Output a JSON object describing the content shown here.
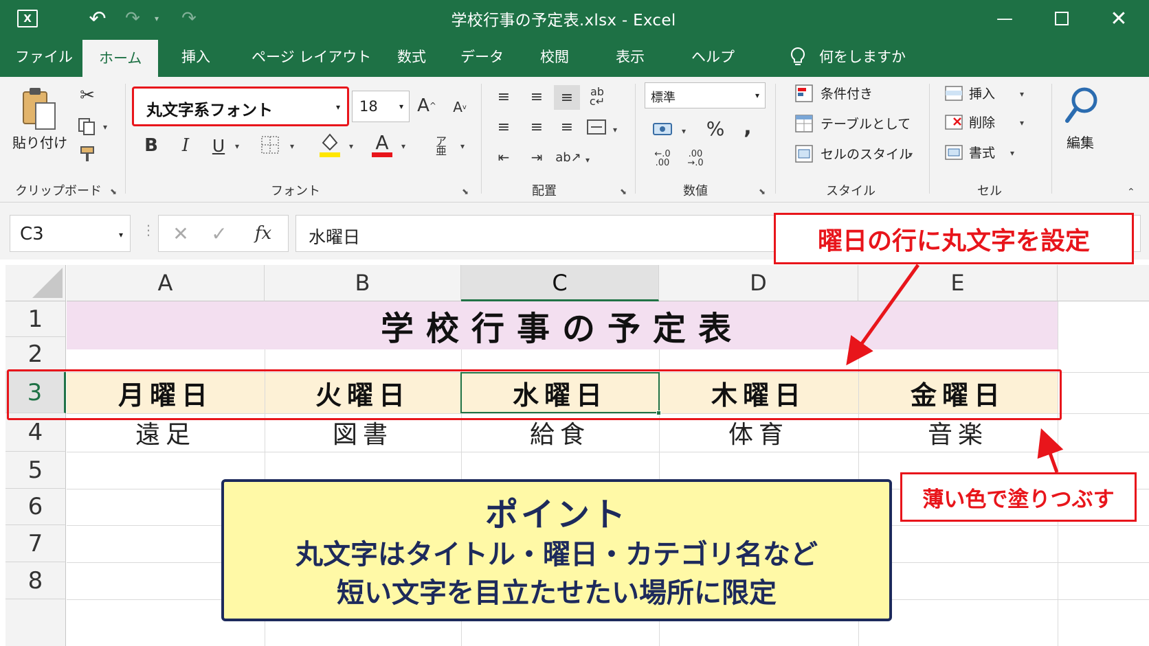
{
  "window": {
    "title": "学校行事の予定表.xlsx  -  Excel",
    "app_icon": "excel-logo-icon"
  },
  "ribbon_tabs": [
    {
      "label": "ファイル"
    },
    {
      "label": "ホーム",
      "active": true
    },
    {
      "label": "挿入"
    },
    {
      "label": "ページ レイアウト"
    },
    {
      "label": "数式"
    },
    {
      "label": "データ"
    },
    {
      "label": "校閲"
    },
    {
      "label": "表示"
    },
    {
      "label": "ヘルプ"
    }
  ],
  "tell_me": {
    "label": "何をしますか",
    "icon": "lightbulb-icon"
  },
  "ribbon": {
    "clipboard": {
      "paste_label": "貼り付け",
      "group_label": "クリップボード"
    },
    "font": {
      "name": "丸文字系フォント",
      "size": "18",
      "bold": "B",
      "italic": "I",
      "underline": "U",
      "group_label": "フォント",
      "fill_color": "#ffe600",
      "font_color": "#e8151b"
    },
    "alignment": {
      "group_label": "配置"
    },
    "number": {
      "format": "標準",
      "percent": "%",
      "comma": ",",
      "group_label": "数値"
    },
    "styles": {
      "conditional": "条件付き",
      "as_table": "テーブルとして",
      "cell_styles": "セルのスタイル",
      "group_label": "スタイル"
    },
    "cells": {
      "insert": "挿入",
      "delete": "削除",
      "format": "書式",
      "group_label": "セル"
    },
    "editing": {
      "label": "編集"
    }
  },
  "formula_bar": {
    "name_box": "C3",
    "fx": "fx",
    "content": "水曜日"
  },
  "sheet": {
    "columns": [
      "A",
      "B",
      "C",
      "D",
      "E"
    ],
    "selected_column": "C",
    "rows": [
      "1",
      "2",
      "3",
      "4",
      "5",
      "6",
      "7",
      "8"
    ],
    "selected_row": "3",
    "title": "学校行事の予定表",
    "title_fill": "#f3dff0",
    "days": [
      "月曜日",
      "火曜日",
      "水曜日",
      "木曜日",
      "金曜日"
    ],
    "day_fill": "#fdf1d6",
    "events": [
      "遠足",
      "図書",
      "給食",
      "体育",
      "音楽"
    ]
  },
  "annotations": {
    "callout_top": "曜日の行に丸文字を設定",
    "callout_right": "薄い色で塗りつぶす",
    "point_title": "ポイント",
    "point_lines": [
      "丸文字はタイトル・曜日・カテゴリ名など",
      "短い文字を目立たせたい場所に限定"
    ],
    "accent_color": "#e8151b",
    "point_fill": "#fff9a6",
    "point_border": "#1d2a5c"
  }
}
